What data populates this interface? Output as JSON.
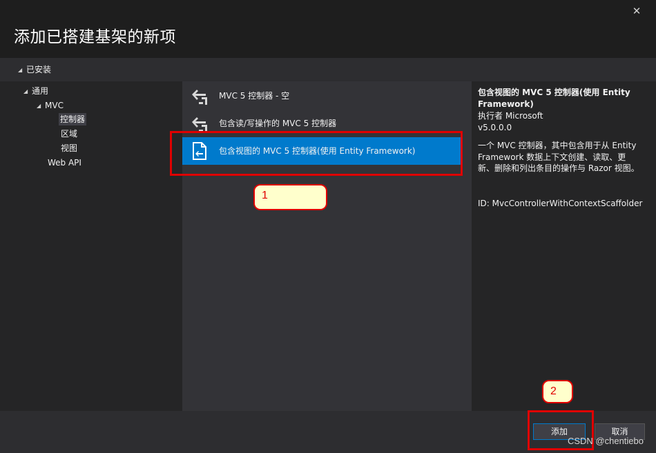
{
  "dialog": {
    "title": "添加已搭建基架的新项",
    "close_glyph": "✕"
  },
  "tree": {
    "root_label": "已安装",
    "arrow_glyph": "◢",
    "items": [
      {
        "label": "通用"
      },
      {
        "label": "MVC"
      },
      {
        "label": "控制器"
      },
      {
        "label": "区域"
      },
      {
        "label": "视图"
      },
      {
        "label": "Web API"
      }
    ]
  },
  "list": {
    "items": [
      {
        "label": "MVC 5 控制器 - 空",
        "icon": "controller-icon"
      },
      {
        "label": "包含读/写操作的 MVC 5 控制器",
        "icon": "controller-icon"
      },
      {
        "label": "包含视图的 MVC 5 控制器(使用 Entity Framework)",
        "icon": "document-controller-icon"
      }
    ],
    "selected_index": 2
  },
  "details": {
    "title": "包含视图的 MVC 5 控制器(使用 Entity Framework)",
    "author": "执行者 Microsoft",
    "version": "v5.0.0.0",
    "description": "一个 MVC 控制器，其中包含用于从 Entity Framework 数据上下文创建、读取、更新、删除和列出条目的操作与 Razor 视图。",
    "id": "ID: MvcControllerWithContextScaffolder"
  },
  "footer": {
    "add_label": "添加",
    "cancel_label": "取消"
  },
  "annotations": {
    "callout_1": "1",
    "callout_2": "2",
    "color": "#e00000"
  },
  "watermark": "CSDN @chentiebo",
  "colors": {
    "accent": "#007acc",
    "background": "#2d2d30",
    "panel": "#252526",
    "list_bg": "#333337"
  }
}
